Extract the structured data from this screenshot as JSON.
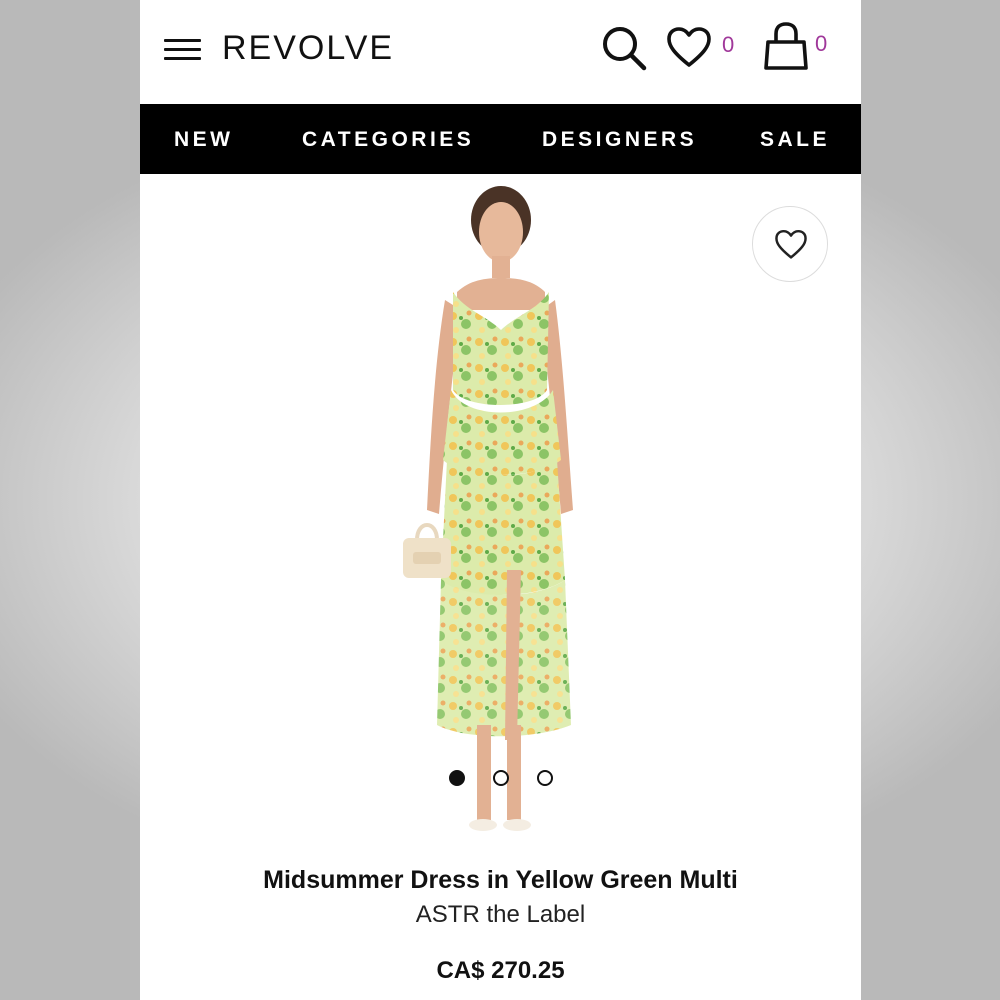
{
  "header": {
    "logo": "REVOLVE",
    "wishlist_count": "0",
    "bag_count": "0",
    "icons": [
      "menu-icon",
      "search-icon",
      "heart-icon",
      "bag-icon"
    ]
  },
  "nav": {
    "items": [
      {
        "label": "NEW"
      },
      {
        "label": "CATEGORIES"
      },
      {
        "label": "DESIGNERS"
      },
      {
        "label": "SALE"
      }
    ]
  },
  "product": {
    "title": "Midsummer Dress in Yellow Green Multi",
    "brand": "ASTR the Label",
    "price": "CA$ 270.25",
    "image_count": 3,
    "active_image": 1
  },
  "colors": {
    "nav_bg": "#000000",
    "count": "#a0389a",
    "dress": "#d9e9a4"
  }
}
